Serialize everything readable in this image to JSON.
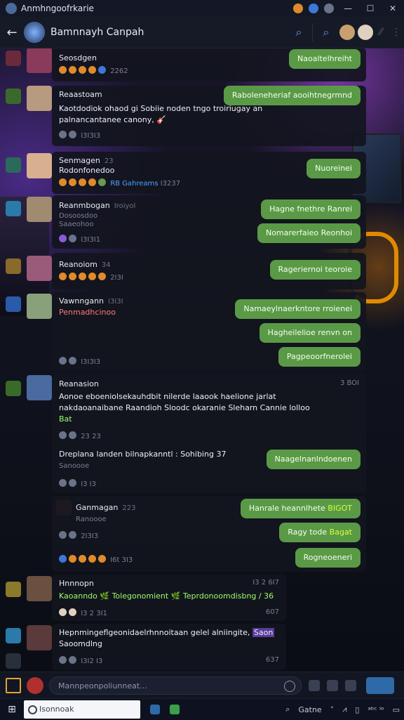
{
  "window": {
    "title": "Anmhngoofrkarie",
    "min": "—",
    "max": "☐",
    "close": "✕"
  },
  "header": {
    "back": "←",
    "group_name": "Bamnnayh Canpah"
  },
  "messages": [
    {
      "sender": "Seosdgen",
      "reactions_label": "2262",
      "bubbles": [
        "Naoaltelhreiht"
      ]
    },
    {
      "sender": "Reaastoam",
      "text_lines": [
        "Kaotdodiok ohaod gi Sobiie noden tngo troiriugay an",
        "palnancantanee canony, 🎸"
      ],
      "reactions_label": "I3I3I3",
      "bubbles": [
        "Raboleneheriaf aooihtnegrmnd"
      ]
    },
    {
      "sender": "Senmagen",
      "meta": "23",
      "sub": "Rodonfonedoo",
      "tags": [
        "RB",
        "Gahreams"
      ],
      "reactions_label": "I3237",
      "bubbles": [
        "Nuoreinei"
      ]
    },
    {
      "sender": "Reanmbogan",
      "meta": "Iroiyol",
      "sub": "Dosoosdoo",
      "sub2": "Saaeohoo",
      "reactions_label": "I3I3I1",
      "bubbles": [
        "Hagne fnethre Ranrei",
        "Nomarerfaieo Reonhoi"
      ]
    },
    {
      "sender": "Reanoiom",
      "meta": "34",
      "reactions_label": "2I3I",
      "bubbles": [
        "Rageriernoi teoroie"
      ]
    },
    {
      "sender": "Vawnngann",
      "meta": "I3I3I",
      "sub": "Penmadhcinoo",
      "reactions_label": "I3I3I3",
      "bubbles": [
        "Namaeylnaerkntore rroienei",
        "Hagheilelioe renvn on",
        "Pagpeoorfnerolei"
      ]
    },
    {
      "sender": "Reanasion",
      "time": "3 BOI",
      "text_lines": [
        "Aonoe eboeniolsekauhdbit nilerde laaook haelione jarlat",
        "nakdaoanaibane Raandioh Sloodc okaranie Sleharn Cannie lolloo",
        "Bat"
      ],
      "reactions_label": "23 23",
      "thread": {
        "text": "Dreplana landen bilnapkanntl : Sohibing 37",
        "sub": "Sanoooe",
        "reactions_label": "I3 I3"
      },
      "bubbles": [
        "Naagelnanlndoenen"
      ]
    },
    {
      "sender": "Ganmagan",
      "meta": "223",
      "sub": "Ranoooe",
      "reactions_label": "2I3I3",
      "footer_label": "I6t 3I3",
      "bubbles": [
        "Hanrale heannlhete",
        "Ragy tode",
        "Rogneoeneri"
      ],
      "bubble_hl": [
        "BIGOT",
        "Bagat"
      ]
    },
    {
      "sender": "Hnnnopn",
      "time": "I3 2 6I7",
      "text_lines": [
        "Kaoanndo 🌿 Tolegonomient 🌿 Teprdonoomdisbng / 36"
      ],
      "reactions_label": "I3 2 3I1",
      "status": "607"
    },
    {
      "sender": "Hepnmingeflgeonidaelrhnnoitaan gelel alniingite,",
      "tag": "Saon",
      "sub": "Saoomdlng",
      "reactions_label": "I3I2 I3",
      "status": "637"
    }
  ],
  "composer": {
    "placeholder": "Mannpeonpoliunneat..."
  },
  "taskbar": {
    "search": "Isonnoak",
    "label1": "Gatne",
    "label2": "iic",
    "label3": "ᵃᵇᶜ ⁱᵒ"
  },
  "colors": {
    "accent": "#4aa3ff",
    "bubble": "#5a9a46",
    "highlight": "#d8ff3a"
  }
}
